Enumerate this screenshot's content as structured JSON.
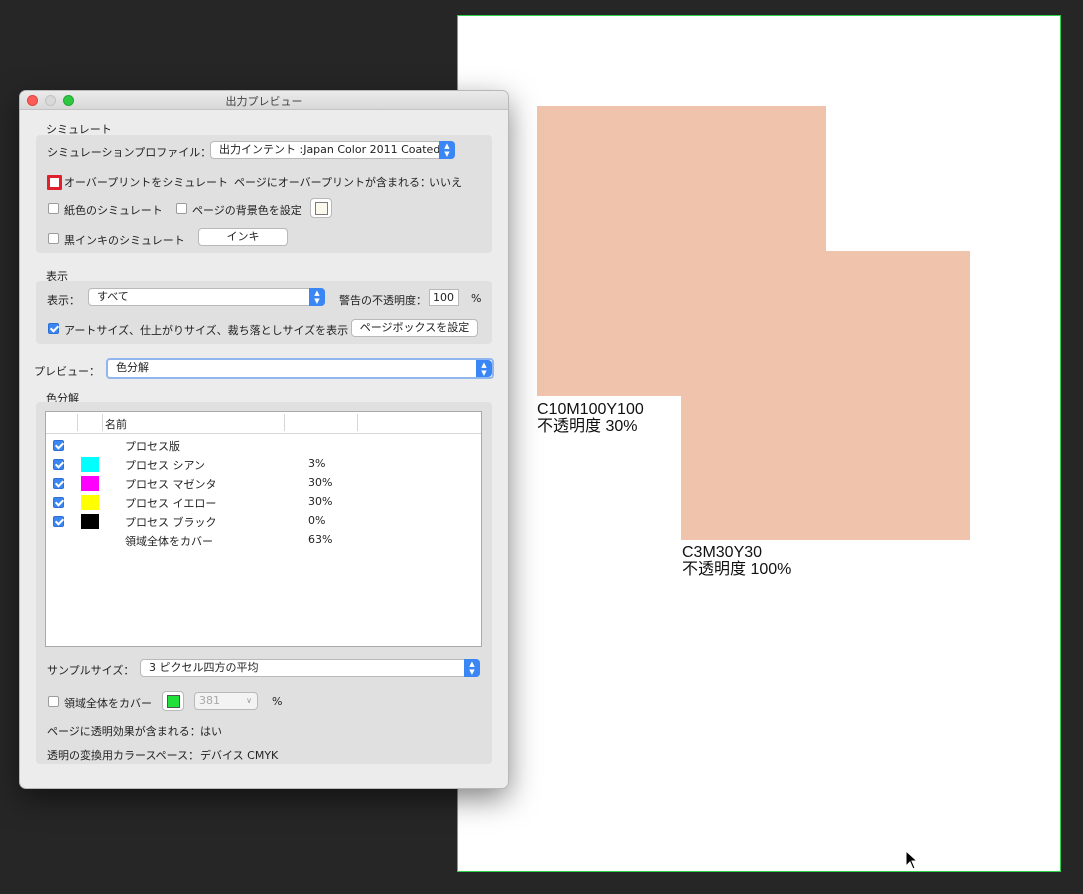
{
  "dialog": {
    "title": "出力プレビュー",
    "simulate": {
      "section_label": "シミュレート",
      "profile_label": "シミュレーションプロファイル：",
      "profile_value": "出力インテント :Japan Color 2011 Coated",
      "overprint_label": "オーバープリントをシミュレート",
      "overprint_checked": false,
      "page_overprint_label": "ページにオーバープリントが含まれる：",
      "page_overprint_value": "いいえ",
      "paper_label": "紙色のシミュレート",
      "bg_color_label": "ページの背景色を設定",
      "black_ink_label": "黒インキのシミュレート",
      "ink_button": "インキ"
    },
    "display": {
      "section_label": "表示",
      "show_label": "表示：",
      "show_value": "すべて",
      "warning_label": "警告の不透明度：",
      "warning_value": "100",
      "warning_unit": "%",
      "artsize_label": "アートサイズ、仕上がりサイズ、裁ち落としサイズを表示",
      "artsize_checked": true,
      "pagebox_button": "ページボックスを設定"
    },
    "preview": {
      "label": "プレビュー：",
      "value": "色分解"
    },
    "separations": {
      "section_label": "色分解",
      "column_name": "名前",
      "rows": [
        {
          "name": "プロセス版",
          "percent": "",
          "checked": true,
          "color": ""
        },
        {
          "name": "プロセス シアン",
          "percent": "3%",
          "checked": true,
          "color": "#00ffff"
        },
        {
          "name": "プロセス マゼンタ",
          "percent": "30%",
          "checked": true,
          "color": "#ff00ff"
        },
        {
          "name": "プロセス イエロー",
          "percent": "30%",
          "checked": true,
          "color": "#ffff00"
        },
        {
          "name": "プロセス ブラック",
          "percent": "0%",
          "checked": true,
          "color": "#000000"
        },
        {
          "name": "領域全体をカバー",
          "percent": "63%",
          "checked": false,
          "color": ""
        }
      ]
    },
    "sample": {
      "label": "サンプルサイズ：",
      "value": "3 ピクセル四方の平均"
    },
    "coverage": {
      "label": "領域全体をカバー",
      "swatch_color": "#22e03a",
      "value": "381",
      "unit": "%"
    },
    "transparency": {
      "label": "ページに透明効果が含まれる：",
      "value": "はい"
    },
    "colorspace": {
      "label": "透明の変換用カラースペース：",
      "value": "デバイス CMYK"
    }
  },
  "artboard": {
    "shape_color": "#f0c3ad",
    "label_a_line1": "C10M100Y100",
    "label_a_line2": "不透明度 30%",
    "label_b_line1": "C3M30Y30",
    "label_b_line2": "不透明度 100%"
  }
}
